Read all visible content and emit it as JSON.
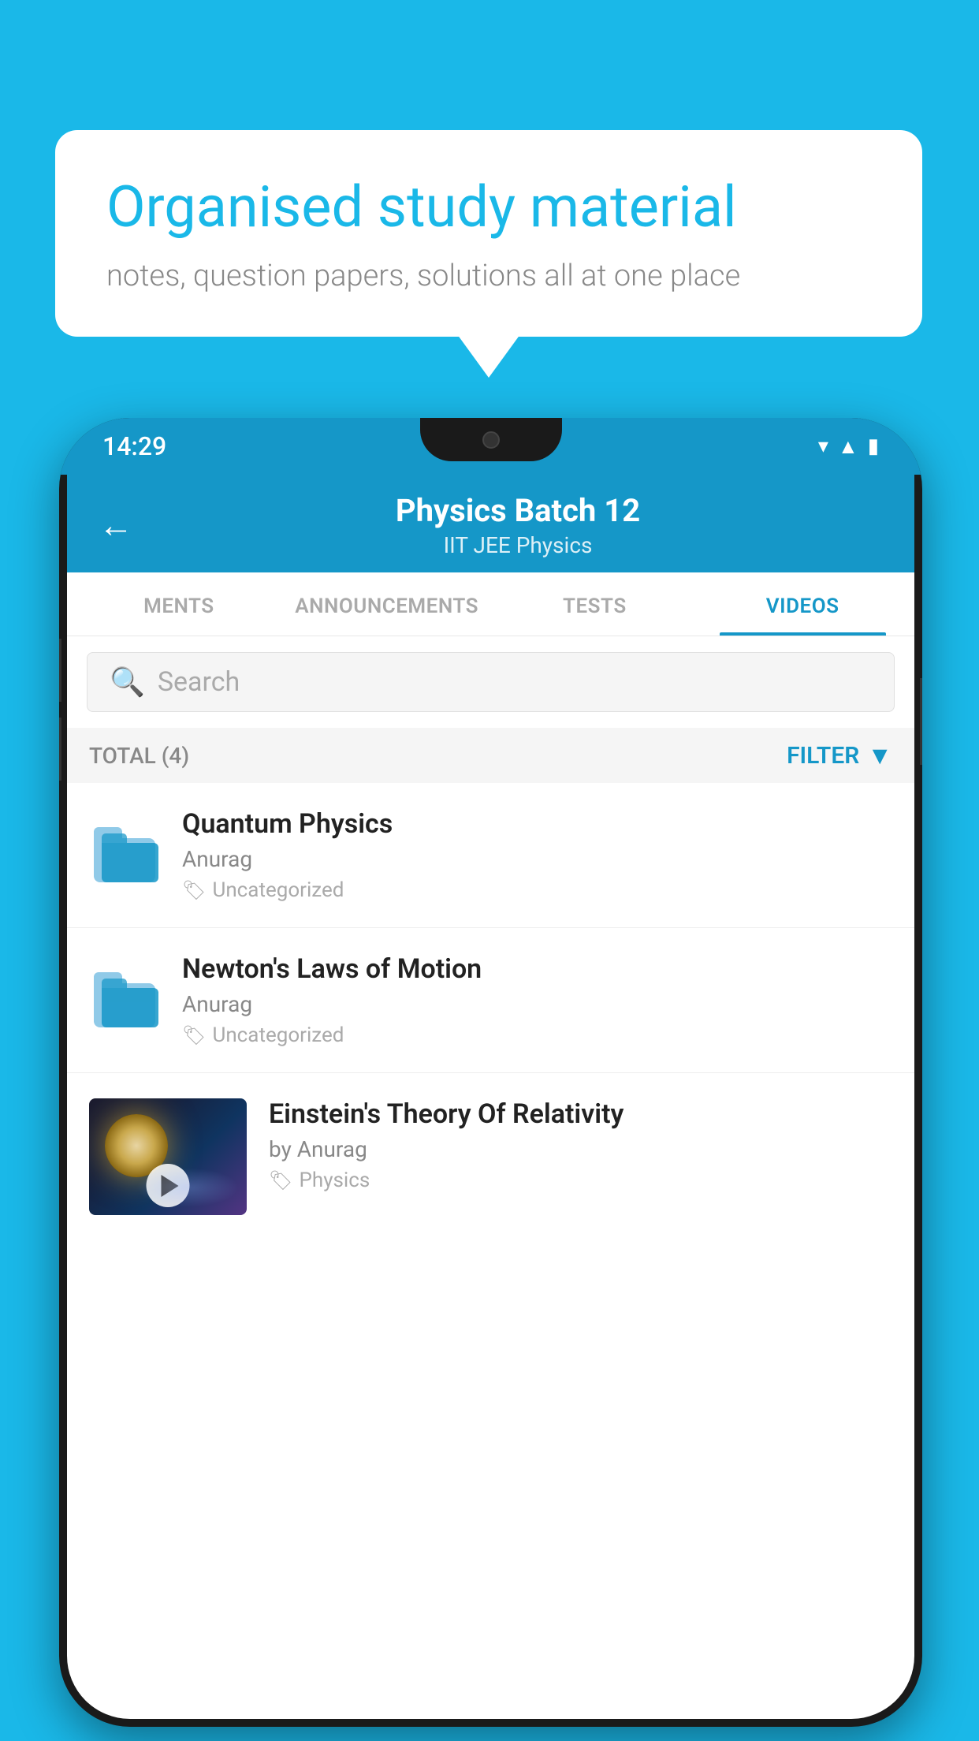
{
  "background_color": "#1ab8e8",
  "speech_bubble": {
    "title": "Organised study material",
    "subtitle": "notes, question papers, solutions all at one place"
  },
  "phone": {
    "status_bar": {
      "time": "14:29",
      "icons": [
        "wifi",
        "signal",
        "battery"
      ]
    },
    "header": {
      "back_label": "←",
      "title": "Physics Batch 12",
      "subtitle": "IIT JEE   Physics"
    },
    "tabs": [
      {
        "label": "MENTS",
        "active": false
      },
      {
        "label": "ANNOUNCEMENTS",
        "active": false
      },
      {
        "label": "TESTS",
        "active": false
      },
      {
        "label": "VIDEOS",
        "active": true
      }
    ],
    "search": {
      "placeholder": "Search"
    },
    "filter_bar": {
      "total_label": "TOTAL (4)",
      "filter_label": "FILTER"
    },
    "videos": [
      {
        "title": "Quantum Physics",
        "author": "Anurag",
        "tag": "Uncategorized",
        "has_thumbnail": false
      },
      {
        "title": "Newton's Laws of Motion",
        "author": "Anurag",
        "tag": "Uncategorized",
        "has_thumbnail": false
      },
      {
        "title": "Einstein's Theory Of Relativity",
        "author": "by Anurag",
        "tag": "Physics",
        "has_thumbnail": true
      }
    ]
  }
}
